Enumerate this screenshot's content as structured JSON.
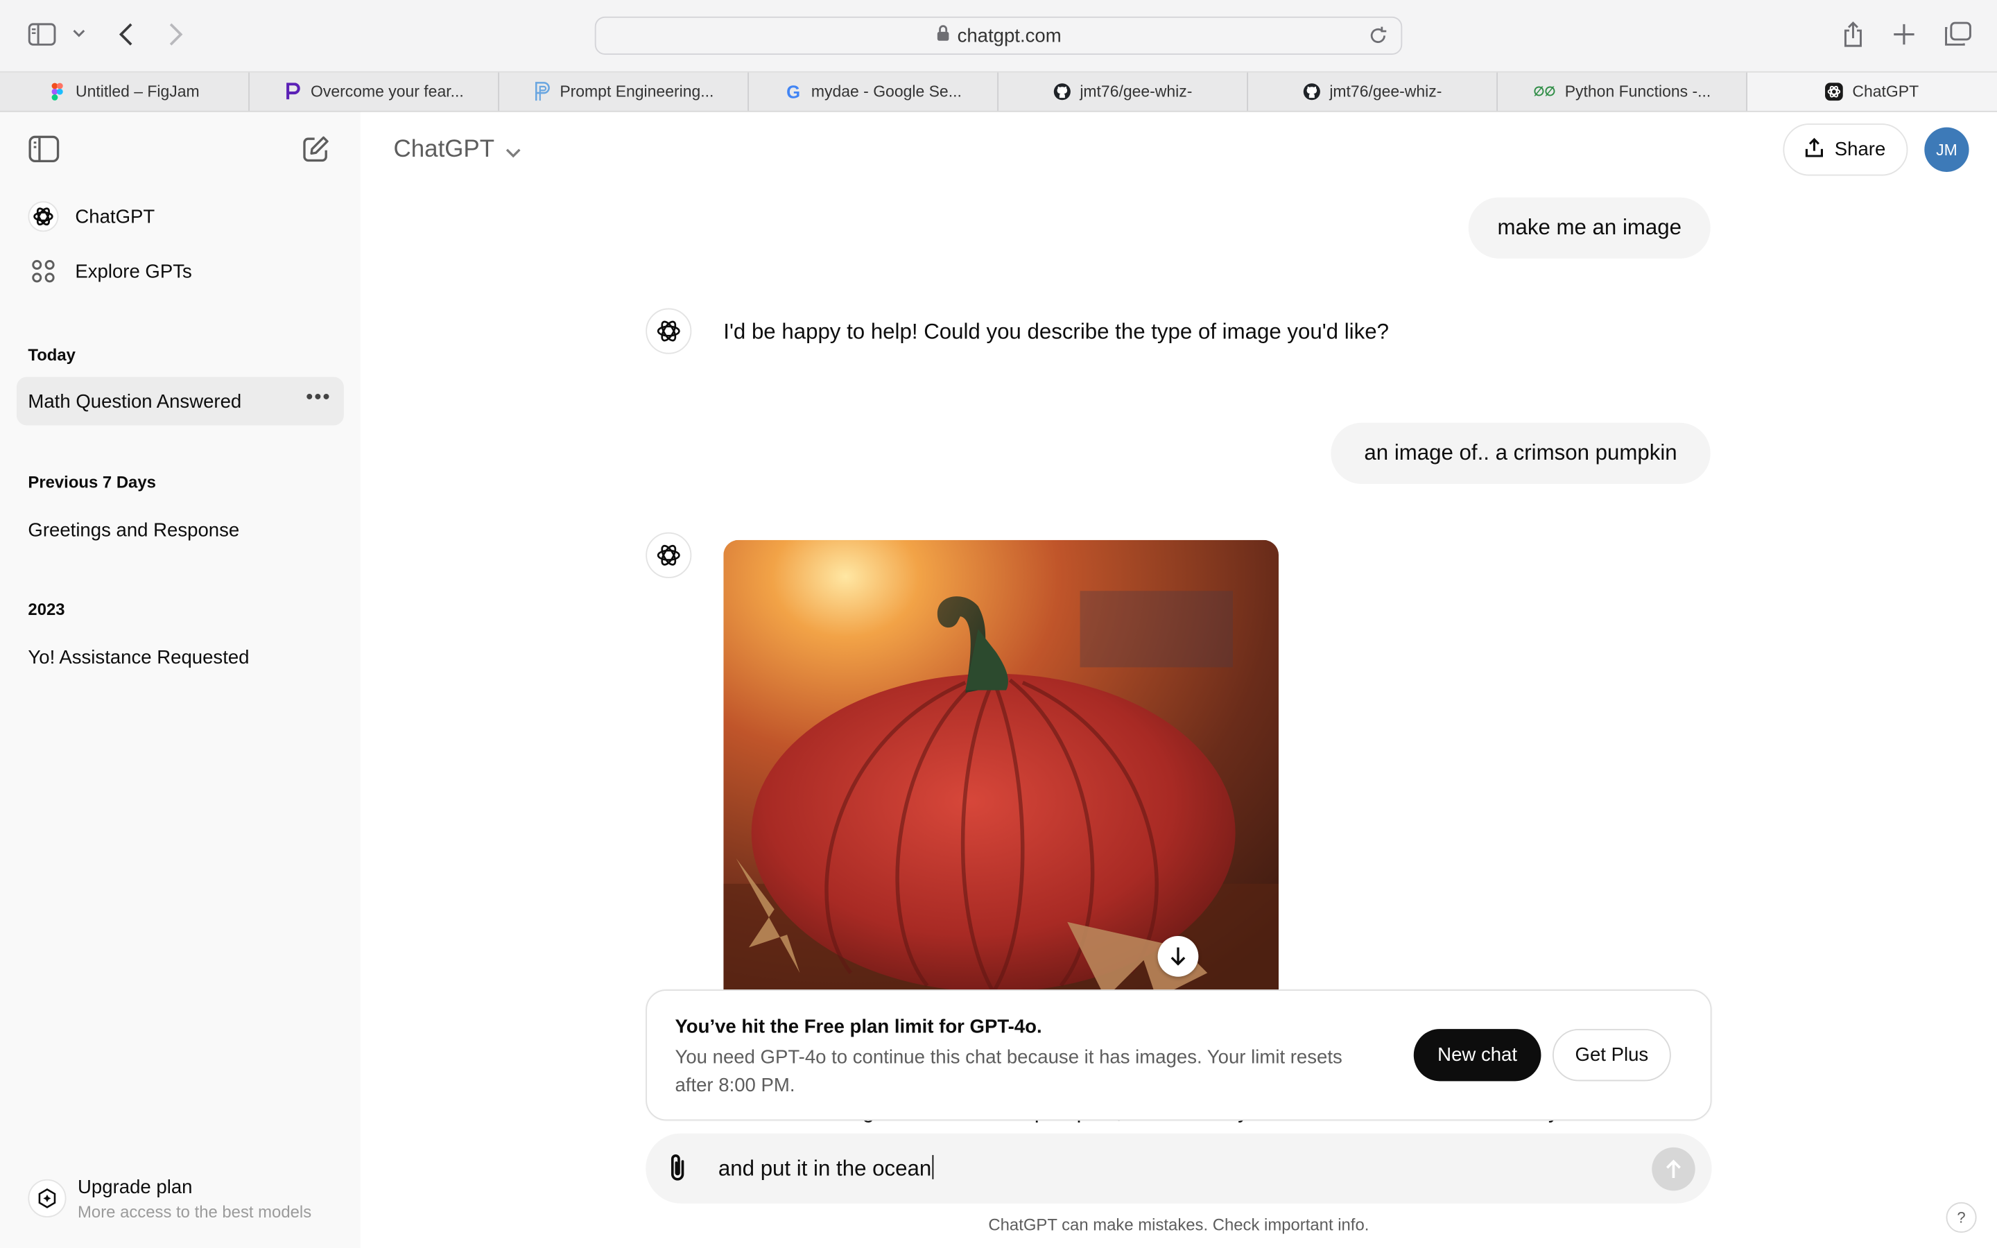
{
  "browser": {
    "url": "chatgpt.com",
    "tabs": [
      {
        "label": "Untitled – FigJam",
        "icon": "figma-icon"
      },
      {
        "label": "Overcome your fear...",
        "icon": "perplexity-icon"
      },
      {
        "label": "Prompt Engineering...",
        "icon": "prompt-icon"
      },
      {
        "label": "mydae - Google Se...",
        "icon": "google-icon"
      },
      {
        "label": "jmt76/gee-whiz-",
        "icon": "github-icon"
      },
      {
        "label": "jmt76/gee-whiz-",
        "icon": "github-icon"
      },
      {
        "label": "Python Functions -...",
        "icon": "gfg-icon"
      },
      {
        "label": "ChatGPT",
        "icon": "chatgpt-icon"
      }
    ]
  },
  "sidebar": {
    "nav": [
      {
        "label": "ChatGPT",
        "icon": "chatgpt-logo-icon"
      },
      {
        "label": "Explore GPTs",
        "icon": "grid-icon"
      }
    ],
    "sections": [
      {
        "title": "Today",
        "items": [
          "Math Question Answered"
        ]
      },
      {
        "title": "Previous 7 Days",
        "items": [
          "Greetings and Response"
        ]
      },
      {
        "title": "2023",
        "items": [
          "Yo! Assistance Requested"
        ]
      }
    ],
    "upgrade": {
      "title": "Upgrade plan",
      "subtitle": "More access to the best models"
    }
  },
  "header": {
    "model": "ChatGPT",
    "share_label": "Share",
    "avatar_initials": "JM"
  },
  "conversation": {
    "user_1": "make me an image",
    "bot_1": "I'd be happy to help! Could you describe the type of image you'd like?",
    "user_2": "an image of.. a crimson pumpkin",
    "bot_2_partial": "Here's the image of the crimson pumpkin, set in a cozy autumn scene. Let me know if you'd like"
  },
  "limit_notice": {
    "title": "You’ve hit the Free plan limit for GPT-4o.",
    "body": "You need GPT-4o to continue this chat because it has images. Your limit resets after 8:00 PM.",
    "new_chat_label": "New chat",
    "get_plus_label": "Get Plus"
  },
  "composer": {
    "value": "and put it in the ocean"
  },
  "footer": {
    "note": "ChatGPT can make mistakes. Check important info.",
    "help": "?"
  }
}
